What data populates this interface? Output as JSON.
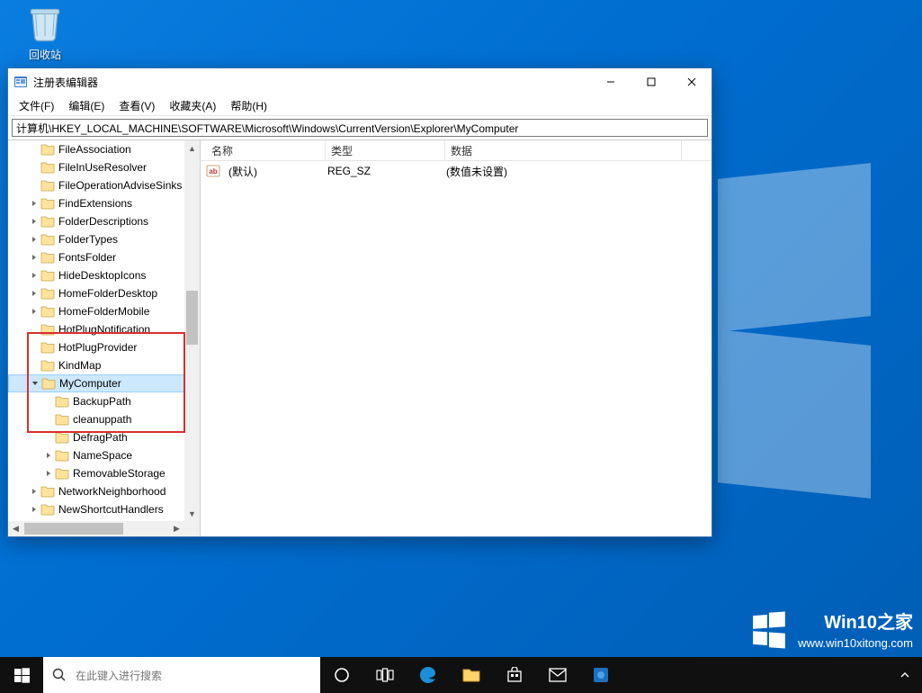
{
  "desktop": {
    "recycle_bin_label": "回收站"
  },
  "window": {
    "title": "注册表编辑器",
    "minimize_name": "minimize-button",
    "maximize_name": "maximize-button",
    "close_name": "close-button"
  },
  "menubar": {
    "items": [
      {
        "label": "文件(F)"
      },
      {
        "label": "编辑(E)"
      },
      {
        "label": "查看(V)"
      },
      {
        "label": "收藏夹(A)"
      },
      {
        "label": "帮助(H)"
      }
    ]
  },
  "addressbar": {
    "value": "计算机\\HKEY_LOCAL_MACHINE\\SOFTWARE\\Microsoft\\Windows\\CurrentVersion\\Explorer\\MyComputer"
  },
  "tree": {
    "items": [
      {
        "indent": 1,
        "expander": "",
        "label": "FileAssociation",
        "selected": false
      },
      {
        "indent": 1,
        "expander": "",
        "label": "FileInUseResolver",
        "selected": false
      },
      {
        "indent": 1,
        "expander": "",
        "label": "FileOperationAdviseSinks",
        "selected": false
      },
      {
        "indent": 1,
        "expander": ">",
        "label": "FindExtensions",
        "selected": false
      },
      {
        "indent": 1,
        "expander": ">",
        "label": "FolderDescriptions",
        "selected": false
      },
      {
        "indent": 1,
        "expander": ">",
        "label": "FolderTypes",
        "selected": false
      },
      {
        "indent": 1,
        "expander": ">",
        "label": "FontsFolder",
        "selected": false
      },
      {
        "indent": 1,
        "expander": ">",
        "label": "HideDesktopIcons",
        "selected": false
      },
      {
        "indent": 1,
        "expander": ">",
        "label": "HomeFolderDesktop",
        "selected": false
      },
      {
        "indent": 1,
        "expander": ">",
        "label": "HomeFolderMobile",
        "selected": false
      },
      {
        "indent": 1,
        "expander": "",
        "label": "HotPlugNotification",
        "selected": false
      },
      {
        "indent": 1,
        "expander": "",
        "label": "HotPlugProvider",
        "selected": false
      },
      {
        "indent": 1,
        "expander": "",
        "label": "KindMap",
        "selected": false
      },
      {
        "indent": 1,
        "expander": "v",
        "label": "MyComputer",
        "selected": true
      },
      {
        "indent": 2,
        "expander": "",
        "label": "BackupPath",
        "selected": false
      },
      {
        "indent": 2,
        "expander": "",
        "label": "cleanuppath",
        "selected": false
      },
      {
        "indent": 2,
        "expander": "",
        "label": "DefragPath",
        "selected": false
      },
      {
        "indent": 2,
        "expander": ">",
        "label": "NameSpace",
        "selected": false
      },
      {
        "indent": 2,
        "expander": ">",
        "label": "RemovableStorage",
        "selected": false
      },
      {
        "indent": 1,
        "expander": ">",
        "label": "NetworkNeighborhood",
        "selected": false
      },
      {
        "indent": 1,
        "expander": ">",
        "label": "NewShortcutHandlers",
        "selected": false
      }
    ]
  },
  "list": {
    "columns": {
      "name": "名称",
      "type": "类型",
      "data": "数据"
    },
    "column_widths": {
      "name": 120,
      "type": 120,
      "data": 250
    },
    "rows": [
      {
        "name": "(默认)",
        "type": "REG_SZ",
        "data": "(数值未设置)"
      }
    ]
  },
  "taskbar": {
    "search_placeholder": "在此键入进行搜索"
  },
  "watermark": {
    "line1": "Win10之家",
    "line2": "www.win10xitong.com"
  }
}
